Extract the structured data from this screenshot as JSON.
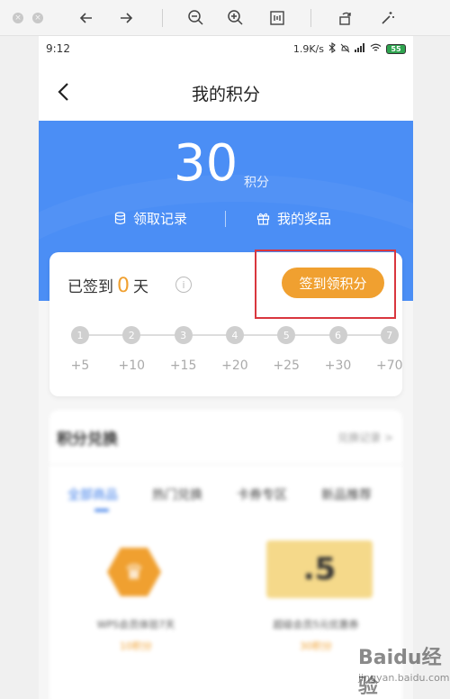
{
  "status_bar": {
    "time": "9:12",
    "speed": "1.9K/s",
    "battery": "55"
  },
  "navbar": {
    "title": "我的积分"
  },
  "hero": {
    "points": "30",
    "points_unit": "积分",
    "links": [
      "领取记录",
      "我的奖品"
    ]
  },
  "checkin": {
    "prefix": "已签到",
    "count": "0",
    "suffix": "天",
    "button_label": "签到领积分",
    "days": [
      "1",
      "2",
      "3",
      "4",
      "5",
      "6",
      "7"
    ],
    "rewards": [
      "+5",
      "+10",
      "+15",
      "+20",
      "+25",
      "+30",
      "+70"
    ]
  },
  "mall": {
    "title": "积分兑换",
    "more": "兑换记录 >",
    "tabs": [
      "全部商品",
      "热门兑换",
      "卡券专区",
      "新品推荐"
    ],
    "products": [
      {
        "name": "WPS会员体验7天",
        "price": "10积分"
      },
      {
        "name": "超级会员5元优惠券",
        "price": "30积分",
        "badge": ".5"
      }
    ]
  },
  "watermark": {
    "text": "Baidu经验",
    "url": "jingyan.baidu.com"
  },
  "colors": {
    "primary": "#4b8ef5",
    "accent": "#f0a030",
    "highlight": "#d9363e"
  }
}
